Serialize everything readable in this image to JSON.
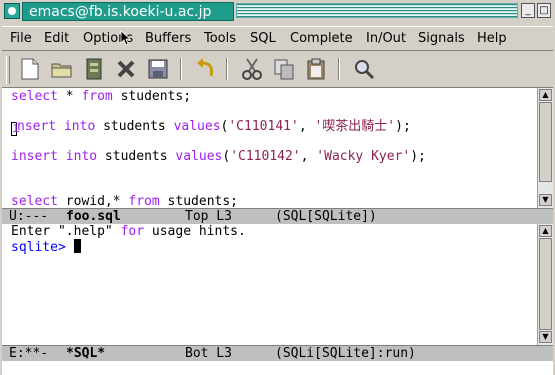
{
  "window": {
    "title": "emacs@fb.is.koeki-u.ac.jp"
  },
  "menubar": {
    "items": [
      "File",
      "Edit",
      "Options",
      "Buffers",
      "Tools",
      "SQL",
      "Complete",
      "In/Out",
      "Signals",
      "Help"
    ]
  },
  "toolbar": {
    "buttons": [
      "new-file-icon",
      "open-folder-icon",
      "dired-icon",
      "close-icon",
      "save-icon",
      "undo-icon",
      "cut-icon",
      "copy-icon",
      "paste-icon",
      "search-icon"
    ]
  },
  "editor": {
    "line1": {
      "k1": "select",
      "t1": " * ",
      "k2": "from",
      "t2": " students;"
    },
    "line2": {
      "c": "i",
      "k1": "nsert",
      "t1": " ",
      "k2": "into",
      "t2": " students ",
      "k3": "values",
      "t3": "(",
      "s1": "'C110141'",
      "t4": ", ",
      "s2": "'喫茶出騎士'",
      "t5": ");"
    },
    "line3": {
      "k1": "insert",
      "t1": " ",
      "k2": "into",
      "t2": " students ",
      "k3": "values",
      "t3": "(",
      "s1": "'C110142'",
      "t4": ", ",
      "s2": "'Wacky Kyer'",
      "t5": ");"
    },
    "line4": {
      "k1": "select",
      "t1": " rowid,* ",
      "k2": "from",
      "t2": " students;"
    },
    "modeline": {
      "status": "U:---",
      "buffer": "foo.sql",
      "pos": "Top L3",
      "mode": "(SQL[SQLite])"
    }
  },
  "repl": {
    "line1": {
      "t1": "Enter \".help\" ",
      "k1": "for",
      "t2": " usage hints."
    },
    "prompt": "sqlite>",
    "modeline": {
      "status": "E:**-",
      "buffer": "*SQL*",
      "pos": "Bot L3",
      "mode": "(SQLi[SQLite]:run)"
    }
  },
  "colors": {
    "keyword": "#a020f0",
    "string": "#8b2252",
    "prompt": "#0000ff",
    "titlebar": "#1f9b8c"
  }
}
